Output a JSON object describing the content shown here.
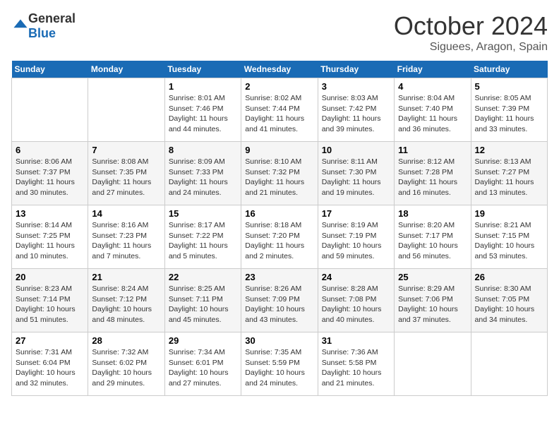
{
  "header": {
    "logo": {
      "general": "General",
      "blue": "Blue"
    },
    "month": "October 2024",
    "location": "Siguees, Aragon, Spain"
  },
  "weekdays": [
    "Sunday",
    "Monday",
    "Tuesday",
    "Wednesday",
    "Thursday",
    "Friday",
    "Saturday"
  ],
  "weeks": [
    [
      {
        "day": "",
        "info": ""
      },
      {
        "day": "",
        "info": ""
      },
      {
        "day": "1",
        "info": "Sunrise: 8:01 AM\nSunset: 7:46 PM\nDaylight: 11 hours and 44 minutes."
      },
      {
        "day": "2",
        "info": "Sunrise: 8:02 AM\nSunset: 7:44 PM\nDaylight: 11 hours and 41 minutes."
      },
      {
        "day": "3",
        "info": "Sunrise: 8:03 AM\nSunset: 7:42 PM\nDaylight: 11 hours and 39 minutes."
      },
      {
        "day": "4",
        "info": "Sunrise: 8:04 AM\nSunset: 7:40 PM\nDaylight: 11 hours and 36 minutes."
      },
      {
        "day": "5",
        "info": "Sunrise: 8:05 AM\nSunset: 7:39 PM\nDaylight: 11 hours and 33 minutes."
      }
    ],
    [
      {
        "day": "6",
        "info": "Sunrise: 8:06 AM\nSunset: 7:37 PM\nDaylight: 11 hours and 30 minutes."
      },
      {
        "day": "7",
        "info": "Sunrise: 8:08 AM\nSunset: 7:35 PM\nDaylight: 11 hours and 27 minutes."
      },
      {
        "day": "8",
        "info": "Sunrise: 8:09 AM\nSunset: 7:33 PM\nDaylight: 11 hours and 24 minutes."
      },
      {
        "day": "9",
        "info": "Sunrise: 8:10 AM\nSunset: 7:32 PM\nDaylight: 11 hours and 21 minutes."
      },
      {
        "day": "10",
        "info": "Sunrise: 8:11 AM\nSunset: 7:30 PM\nDaylight: 11 hours and 19 minutes."
      },
      {
        "day": "11",
        "info": "Sunrise: 8:12 AM\nSunset: 7:28 PM\nDaylight: 11 hours and 16 minutes."
      },
      {
        "day": "12",
        "info": "Sunrise: 8:13 AM\nSunset: 7:27 PM\nDaylight: 11 hours and 13 minutes."
      }
    ],
    [
      {
        "day": "13",
        "info": "Sunrise: 8:14 AM\nSunset: 7:25 PM\nDaylight: 11 hours and 10 minutes."
      },
      {
        "day": "14",
        "info": "Sunrise: 8:16 AM\nSunset: 7:23 PM\nDaylight: 11 hours and 7 minutes."
      },
      {
        "day": "15",
        "info": "Sunrise: 8:17 AM\nSunset: 7:22 PM\nDaylight: 11 hours and 5 minutes."
      },
      {
        "day": "16",
        "info": "Sunrise: 8:18 AM\nSunset: 7:20 PM\nDaylight: 11 hours and 2 minutes."
      },
      {
        "day": "17",
        "info": "Sunrise: 8:19 AM\nSunset: 7:19 PM\nDaylight: 10 hours and 59 minutes."
      },
      {
        "day": "18",
        "info": "Sunrise: 8:20 AM\nSunset: 7:17 PM\nDaylight: 10 hours and 56 minutes."
      },
      {
        "day": "19",
        "info": "Sunrise: 8:21 AM\nSunset: 7:15 PM\nDaylight: 10 hours and 53 minutes."
      }
    ],
    [
      {
        "day": "20",
        "info": "Sunrise: 8:23 AM\nSunset: 7:14 PM\nDaylight: 10 hours and 51 minutes."
      },
      {
        "day": "21",
        "info": "Sunrise: 8:24 AM\nSunset: 7:12 PM\nDaylight: 10 hours and 48 minutes."
      },
      {
        "day": "22",
        "info": "Sunrise: 8:25 AM\nSunset: 7:11 PM\nDaylight: 10 hours and 45 minutes."
      },
      {
        "day": "23",
        "info": "Sunrise: 8:26 AM\nSunset: 7:09 PM\nDaylight: 10 hours and 43 minutes."
      },
      {
        "day": "24",
        "info": "Sunrise: 8:28 AM\nSunset: 7:08 PM\nDaylight: 10 hours and 40 minutes."
      },
      {
        "day": "25",
        "info": "Sunrise: 8:29 AM\nSunset: 7:06 PM\nDaylight: 10 hours and 37 minutes."
      },
      {
        "day": "26",
        "info": "Sunrise: 8:30 AM\nSunset: 7:05 PM\nDaylight: 10 hours and 34 minutes."
      }
    ],
    [
      {
        "day": "27",
        "info": "Sunrise: 7:31 AM\nSunset: 6:04 PM\nDaylight: 10 hours and 32 minutes."
      },
      {
        "day": "28",
        "info": "Sunrise: 7:32 AM\nSunset: 6:02 PM\nDaylight: 10 hours and 29 minutes."
      },
      {
        "day": "29",
        "info": "Sunrise: 7:34 AM\nSunset: 6:01 PM\nDaylight: 10 hours and 27 minutes."
      },
      {
        "day": "30",
        "info": "Sunrise: 7:35 AM\nSunset: 5:59 PM\nDaylight: 10 hours and 24 minutes."
      },
      {
        "day": "31",
        "info": "Sunrise: 7:36 AM\nSunset: 5:58 PM\nDaylight: 10 hours and 21 minutes."
      },
      {
        "day": "",
        "info": ""
      },
      {
        "day": "",
        "info": ""
      }
    ]
  ]
}
